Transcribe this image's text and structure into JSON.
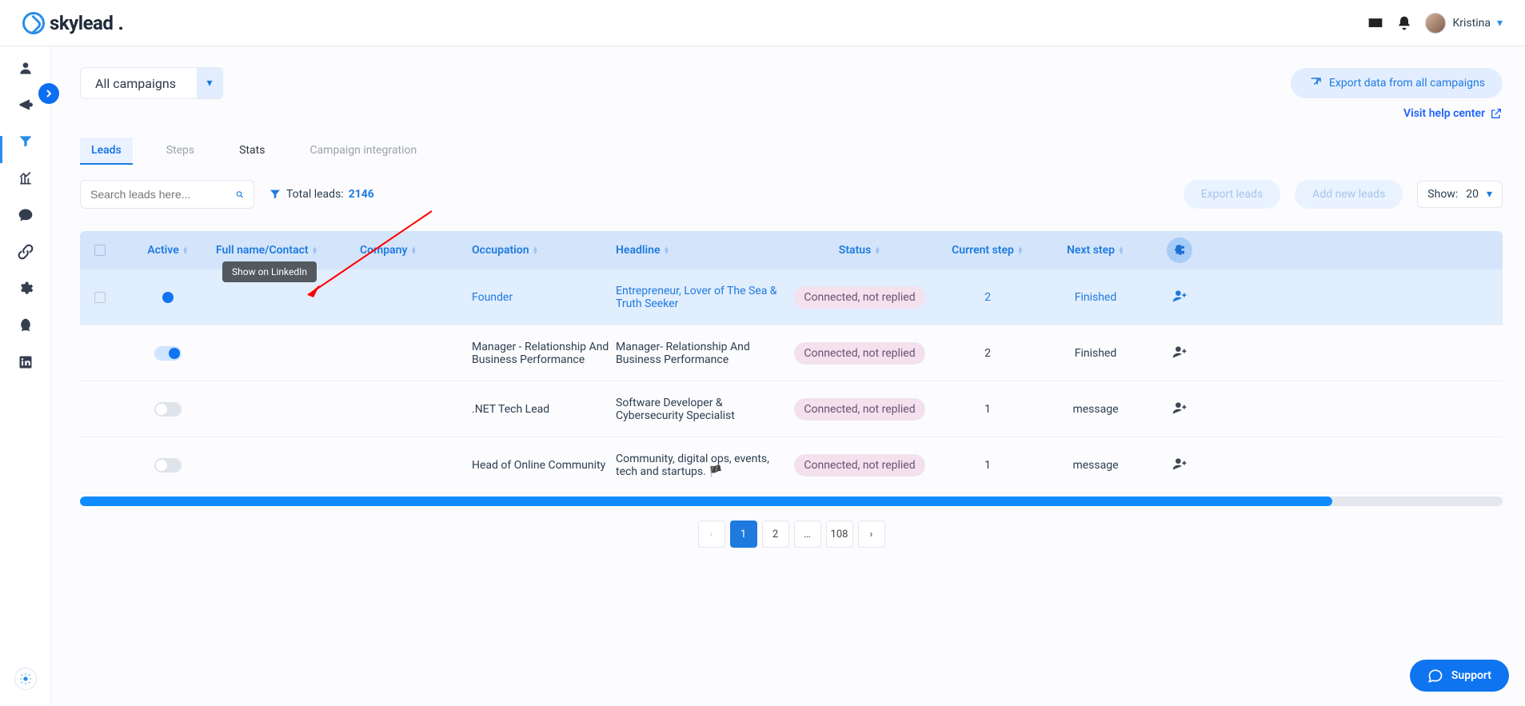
{
  "header": {
    "brand": "skylead",
    "username": "Kristina"
  },
  "campaignSelect": {
    "label": "All campaigns"
  },
  "exportButton": "Export data from all campaigns",
  "helpLink": "Visit help center",
  "tabs": {
    "leads": "Leads",
    "steps": "Steps",
    "stats": "Stats",
    "integration": "Campaign integration"
  },
  "search": {
    "placeholder": "Search leads here..."
  },
  "totalLeads": {
    "label": "Total leads:",
    "value": "2146"
  },
  "pillButtons": {
    "export": "Export leads",
    "add": "Add new leads"
  },
  "show": {
    "label": "Show:",
    "value": "20"
  },
  "columns": {
    "active": "Active",
    "name": "Full name/Contact",
    "company": "Company",
    "occupation": "Occupation",
    "headline": "Headline",
    "status": "Status",
    "currentStep": "Current step",
    "nextStep": "Next step"
  },
  "tooltip": "Show on LinkedIn",
  "rows": [
    {
      "activeStyle": "dot",
      "occupation": "Founder",
      "headline": "Entrepreneur, Lover of The Sea & Truth Seeker",
      "status": "Connected, not replied",
      "currentStep": "2",
      "nextStep": "Finished",
      "highlighted": true
    },
    {
      "activeStyle": "toggle-on",
      "occupation": "Manager - Relationship And Business Performance",
      "headline": "Manager- Relationship And Business Performance",
      "status": "Connected, not replied",
      "currentStep": "2",
      "nextStep": "Finished",
      "highlighted": false
    },
    {
      "activeStyle": "toggle-off",
      "occupation": ".NET Tech Lead",
      "headline": "Software Developer & Cybersecurity Specialist",
      "status": "Connected, not replied",
      "currentStep": "1",
      "nextStep": "message",
      "highlighted": false
    },
    {
      "activeStyle": "toggle-off",
      "occupation": "Head of Online Community",
      "headline": "Community, digital ops, events, tech and startups. 🏴",
      "status": "Connected, not replied",
      "currentStep": "1",
      "nextStep": "message",
      "highlighted": false
    }
  ],
  "pagination": {
    "p1": "1",
    "p2": "2",
    "dots": "…",
    "last": "108"
  },
  "support": "Support"
}
